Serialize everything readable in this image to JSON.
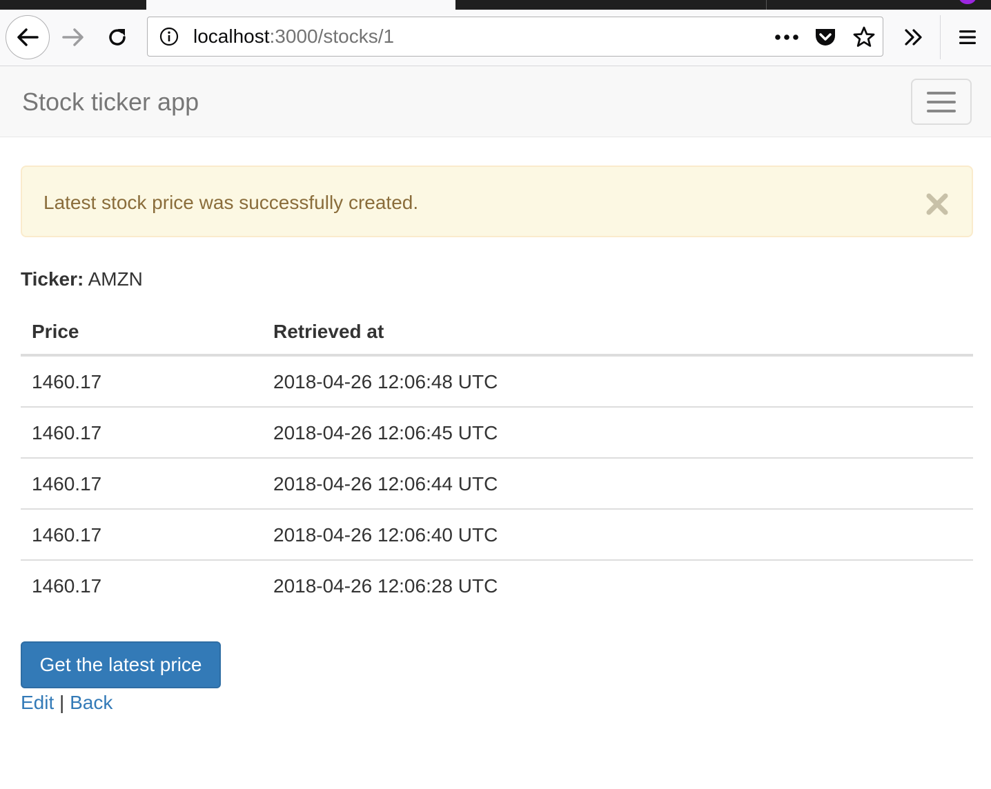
{
  "browser": {
    "url_host": "localhost",
    "url_path": ":3000/stocks/1"
  },
  "navbar": {
    "brand": "Stock ticker app"
  },
  "alert": {
    "message": "Latest stock price was successfully created."
  },
  "ticker": {
    "label": "Ticker:",
    "value": "AMZN"
  },
  "table": {
    "headers": [
      "Price",
      "Retrieved at"
    ],
    "rows": [
      {
        "price": "1460.17",
        "retrieved_at": "2018-04-26 12:06:48 UTC"
      },
      {
        "price": "1460.17",
        "retrieved_at": "2018-04-26 12:06:45 UTC"
      },
      {
        "price": "1460.17",
        "retrieved_at": "2018-04-26 12:06:44 UTC"
      },
      {
        "price": "1460.17",
        "retrieved_at": "2018-04-26 12:06:40 UTC"
      },
      {
        "price": "1460.17",
        "retrieved_at": "2018-04-26 12:06:28 UTC"
      }
    ]
  },
  "actions": {
    "primary_button": "Get the latest price",
    "edit_link": "Edit",
    "separator": "|",
    "back_link": "Back"
  },
  "colors": {
    "primary": "#337ab7",
    "alert_bg": "#fcf8e3",
    "alert_text": "#8a6d3b",
    "accent_dot": "#9b26e0"
  },
  "icons": [
    "back-arrow-icon",
    "forward-arrow-icon",
    "reload-icon",
    "info-icon",
    "more-dots-icon",
    "pocket-icon",
    "star-icon",
    "overflow-chevron-icon",
    "hamburger-menu-icon",
    "close-icon"
  ]
}
